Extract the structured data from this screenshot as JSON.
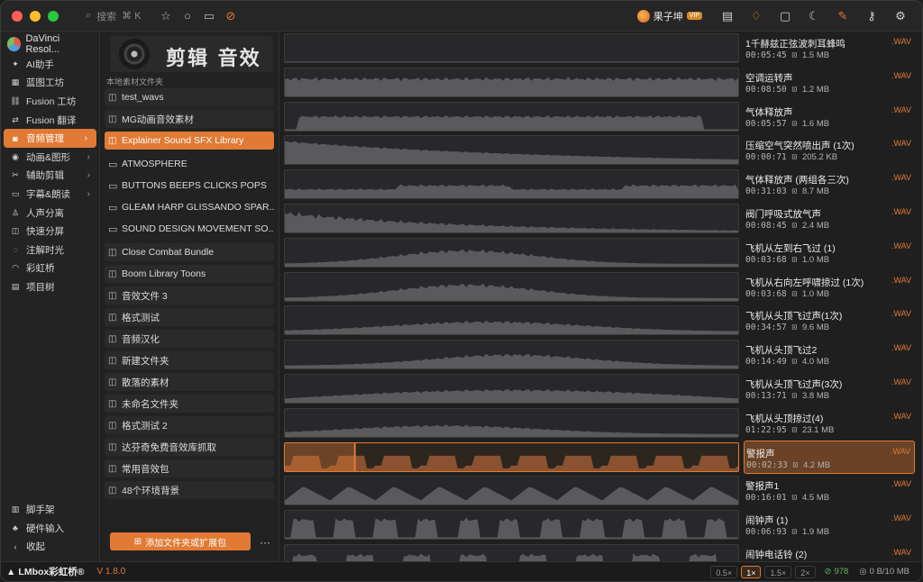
{
  "window": {
    "lights": [
      "#ff5f57",
      "#febc2e",
      "#28c840"
    ]
  },
  "topbar": {
    "search_label": "搜索",
    "search_shortcut": "⌘ K",
    "user_name": "果子坤",
    "vip_badge": "VIP"
  },
  "sidebar": {
    "app_name": "DaVinci Resol...",
    "items": [
      {
        "label": "AI助手",
        "icon": "sparkle-icon"
      },
      {
        "label": "蓝图工坊",
        "icon": "blueprint-icon"
      },
      {
        "label": "Fusion 工坊",
        "icon": "nodes-icon"
      },
      {
        "label": "Fusion 翻译",
        "icon": "translate-icon"
      },
      {
        "label": "音频管理",
        "icon": "headphones-icon"
      },
      {
        "label": "动画&图形",
        "icon": "animation-icon"
      },
      {
        "label": "辅助剪辑",
        "icon": "clip-icon"
      },
      {
        "label": "字幕&朗读",
        "icon": "subtitle-icon"
      },
      {
        "label": "人声分离",
        "icon": "voice-icon"
      },
      {
        "label": "快速分屏",
        "icon": "split-icon"
      },
      {
        "label": "注解时光",
        "icon": "note-icon"
      },
      {
        "label": "彩虹桥",
        "icon": "rainbow-icon"
      },
      {
        "label": "项目树",
        "icon": "tree-icon"
      }
    ],
    "bottom": [
      {
        "label": "脚手架",
        "icon": "scaffold-icon"
      },
      {
        "label": "硬件输入",
        "icon": "hardware-icon"
      },
      {
        "label": "收起",
        "icon": "collapse-icon"
      }
    ]
  },
  "folders": {
    "banner_title": "剪辑 音效",
    "local_label": "本地素材文件夹",
    "items": [
      "test_wavs",
      "MG动画音效素材",
      "Explainer Sound SFX Library",
      "ATMOSPHERE",
      "BUTTONS BEEPS CLICKS POPS",
      "GLEAM HARP GLISSANDO SPAR...",
      "SOUND DESIGN MOVEMENT SO...",
      "Close Combat Bundle",
      "Boom Library Toons",
      "音效文件 3",
      "格式测试",
      "音频汉化",
      "新建文件夹",
      "散落的素材",
      "未命名文件夹",
      "格式测试 2",
      "达芬奇免费音效库抓取",
      "常用音效包",
      "48个环境背景"
    ],
    "add_button": "添加文件夹或扩展包",
    "more_button": "···"
  },
  "sounds": [
    {
      "name": "1千赫兹正弦波刺耳蜂鸣",
      "duration": "00:05:45",
      "size": "1.5 MB",
      "ext": ".WAV",
      "shape": "flat"
    },
    {
      "name": "空调运转声",
      "duration": "00:08:50",
      "size": "1.2 MB",
      "ext": ".WAV",
      "shape": "noise"
    },
    {
      "name": "气体释放声",
      "duration": "00:05:57",
      "size": "1.6 MB",
      "ext": ".WAV",
      "shape": "plateau"
    },
    {
      "name": "压缩空气突然喷出声 (1次)",
      "duration": "00:00:71",
      "size": "205.2 KB",
      "ext": ".WAV",
      "shape": "decay"
    },
    {
      "name": "气体释放声 (两组各三次)",
      "duration": "00:31:03",
      "size": "8.7 MB",
      "ext": ".WAV",
      "shape": "bursts"
    },
    {
      "name": "阀门呼吸式放气声",
      "duration": "00:08:45",
      "size": "2.4 MB",
      "ext": ".WAV",
      "shape": "decay2"
    },
    {
      "name": "飞机从左到右飞过 (1)",
      "duration": "00:03:68",
      "size": "1.0 MB",
      "ext": ".WAV",
      "shape": "hill"
    },
    {
      "name": "飞机从右向左呼啸掠过 (1次)",
      "duration": "00:03:68",
      "size": "1.0 MB",
      "ext": ".WAV",
      "shape": "hill"
    },
    {
      "name": "飞机从头顶飞过声(1次)",
      "duration": "00:34:57",
      "size": "9.6 MB",
      "ext": ".WAV",
      "shape": "hill2"
    },
    {
      "name": "飞机从头顶飞过2",
      "duration": "00:14:49",
      "size": "4.0 MB",
      "ext": ".WAV",
      "shape": "hill3"
    },
    {
      "name": "飞机从头顶飞过声(3次)",
      "duration": "00:13:71",
      "size": "3.8 MB",
      "ext": ".WAV",
      "shape": "hill4"
    },
    {
      "name": "飞机从头顶掠过(4)",
      "duration": "01:22:95",
      "size": "23.1 MB",
      "ext": ".WAV",
      "shape": "hill5"
    },
    {
      "name": "警报声",
      "duration": "00:02:33",
      "size": "4.2 MB",
      "ext": ".WAV",
      "shape": "alarm",
      "selected": true
    },
    {
      "name": "警报声1",
      "duration": "00:16:01",
      "size": "4.5 MB",
      "ext": ".WAV",
      "shape": "saw"
    },
    {
      "name": "闹钟声 (1)",
      "duration": "00:06:93",
      "size": "1.9 MB",
      "ext": ".WAV",
      "shape": "clock"
    },
    {
      "name": "闹钟电话铃 (2)",
      "duration": "",
      "size": "",
      "ext": ".WAV",
      "shape": "clock2"
    }
  ],
  "statusbar": {
    "brand": "LMbox彩虹桥®",
    "version": "V 1.8.0",
    "speeds": [
      "0.5×",
      "1×",
      "1.5×",
      "2×"
    ],
    "active_speed": "1×",
    "count": "978",
    "storage": "0 B/10 MB"
  },
  "colors": {
    "accent": "#e07a34",
    "wave": "#5a5a5c",
    "count": "#62b36a"
  }
}
